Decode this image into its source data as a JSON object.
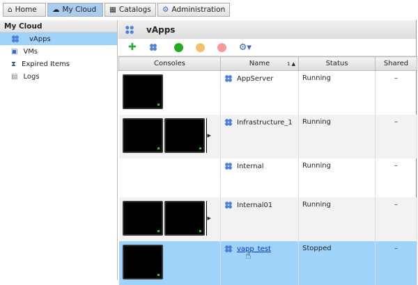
{
  "tabs": [
    {
      "label": "Home"
    },
    {
      "label": "My Cloud"
    },
    {
      "label": "Catalogs"
    },
    {
      "label": "Administration"
    }
  ],
  "sidebar": {
    "title": "My Cloud",
    "items": [
      {
        "label": "vApps"
      },
      {
        "label": "VMs"
      },
      {
        "label": "Expired Items"
      },
      {
        "label": "Logs"
      }
    ]
  },
  "main": {
    "title": "vApps",
    "columns": {
      "consoles": "Consoles",
      "name": "Name",
      "sort": "1 ▲",
      "status": "Status",
      "shared": "Shared"
    },
    "rows": [
      {
        "name": "AppServer",
        "status": "Running",
        "shared": "–"
      },
      {
        "name": "Infrastructure_1",
        "status": "Running",
        "shared": "–"
      },
      {
        "name": "Internal",
        "status": "Running",
        "shared": "–"
      },
      {
        "name": "Internal01",
        "status": "Running",
        "shared": "–"
      },
      {
        "name": "vapp_test",
        "status": "Stopped",
        "shared": "–"
      }
    ]
  }
}
